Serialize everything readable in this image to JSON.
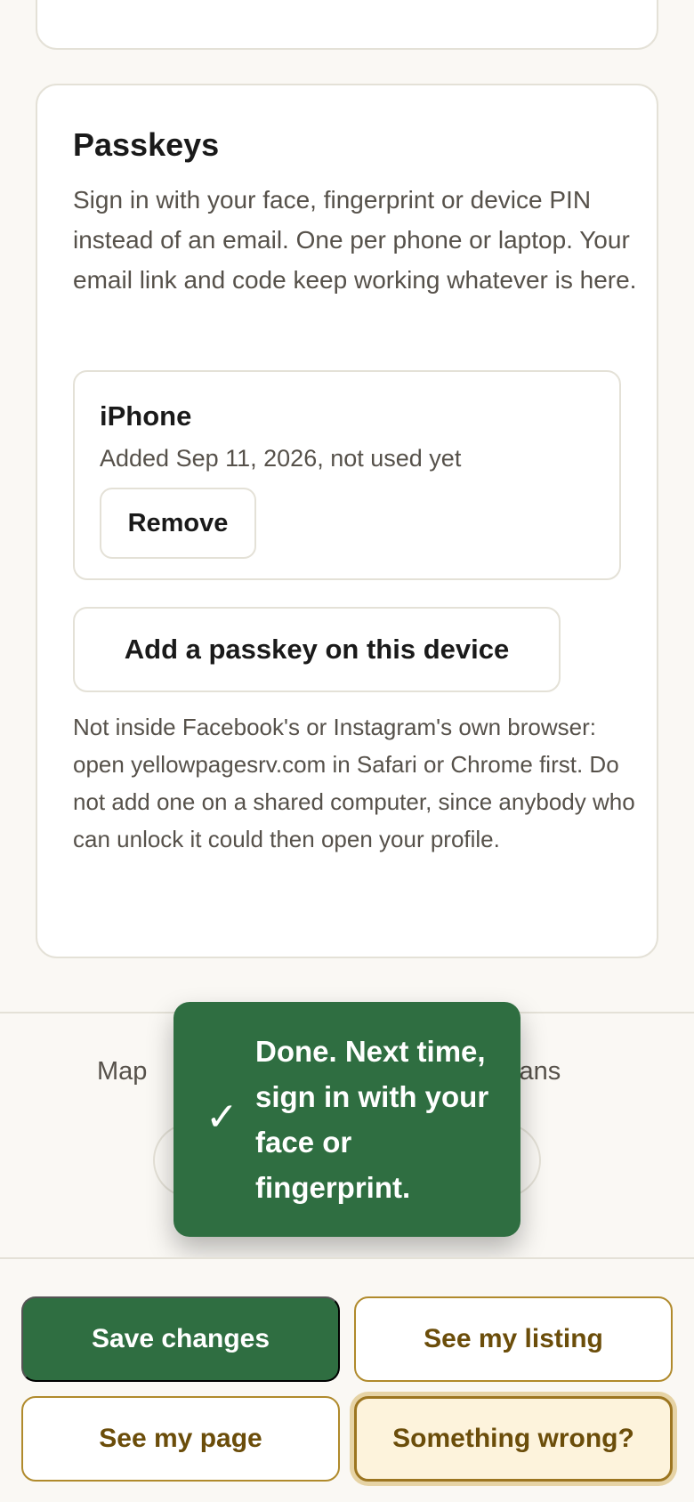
{
  "passkeys": {
    "title": "Passkeys",
    "description": "Sign in with your face, fingerprint or device PIN instead of an email. One per phone or laptop. Your email link and code keep working whatever is here.",
    "devices": [
      {
        "name": "iPhone",
        "meta": "Added Sep 11, 2026, not used yet",
        "remove_label": "Remove"
      }
    ],
    "add_label": "Add a passkey on this device",
    "note": "Not inside Facebook's or Instagram's own browser: open yellowpagesrv.com in Safari or Chrome first. Do not add one on a shared computer, since anybody who can unlock it could then open your profile."
  },
  "footer": {
    "link_map": "Map",
    "link_technicians": "nicians"
  },
  "toast": {
    "icon": "check-icon",
    "check_glyph": "✓",
    "message": "Done. Next time, sign in with your face or fingerprint."
  },
  "actions": {
    "save": "Save changes",
    "see_listing": "See my listing",
    "see_page": "See my page",
    "something_wrong": "Something wrong?"
  },
  "colors": {
    "primary_green": "#2f6e41",
    "accent_gold": "#6b4d0a",
    "highlight_cream": "#fdf3dc",
    "background": "#faf8f4"
  }
}
